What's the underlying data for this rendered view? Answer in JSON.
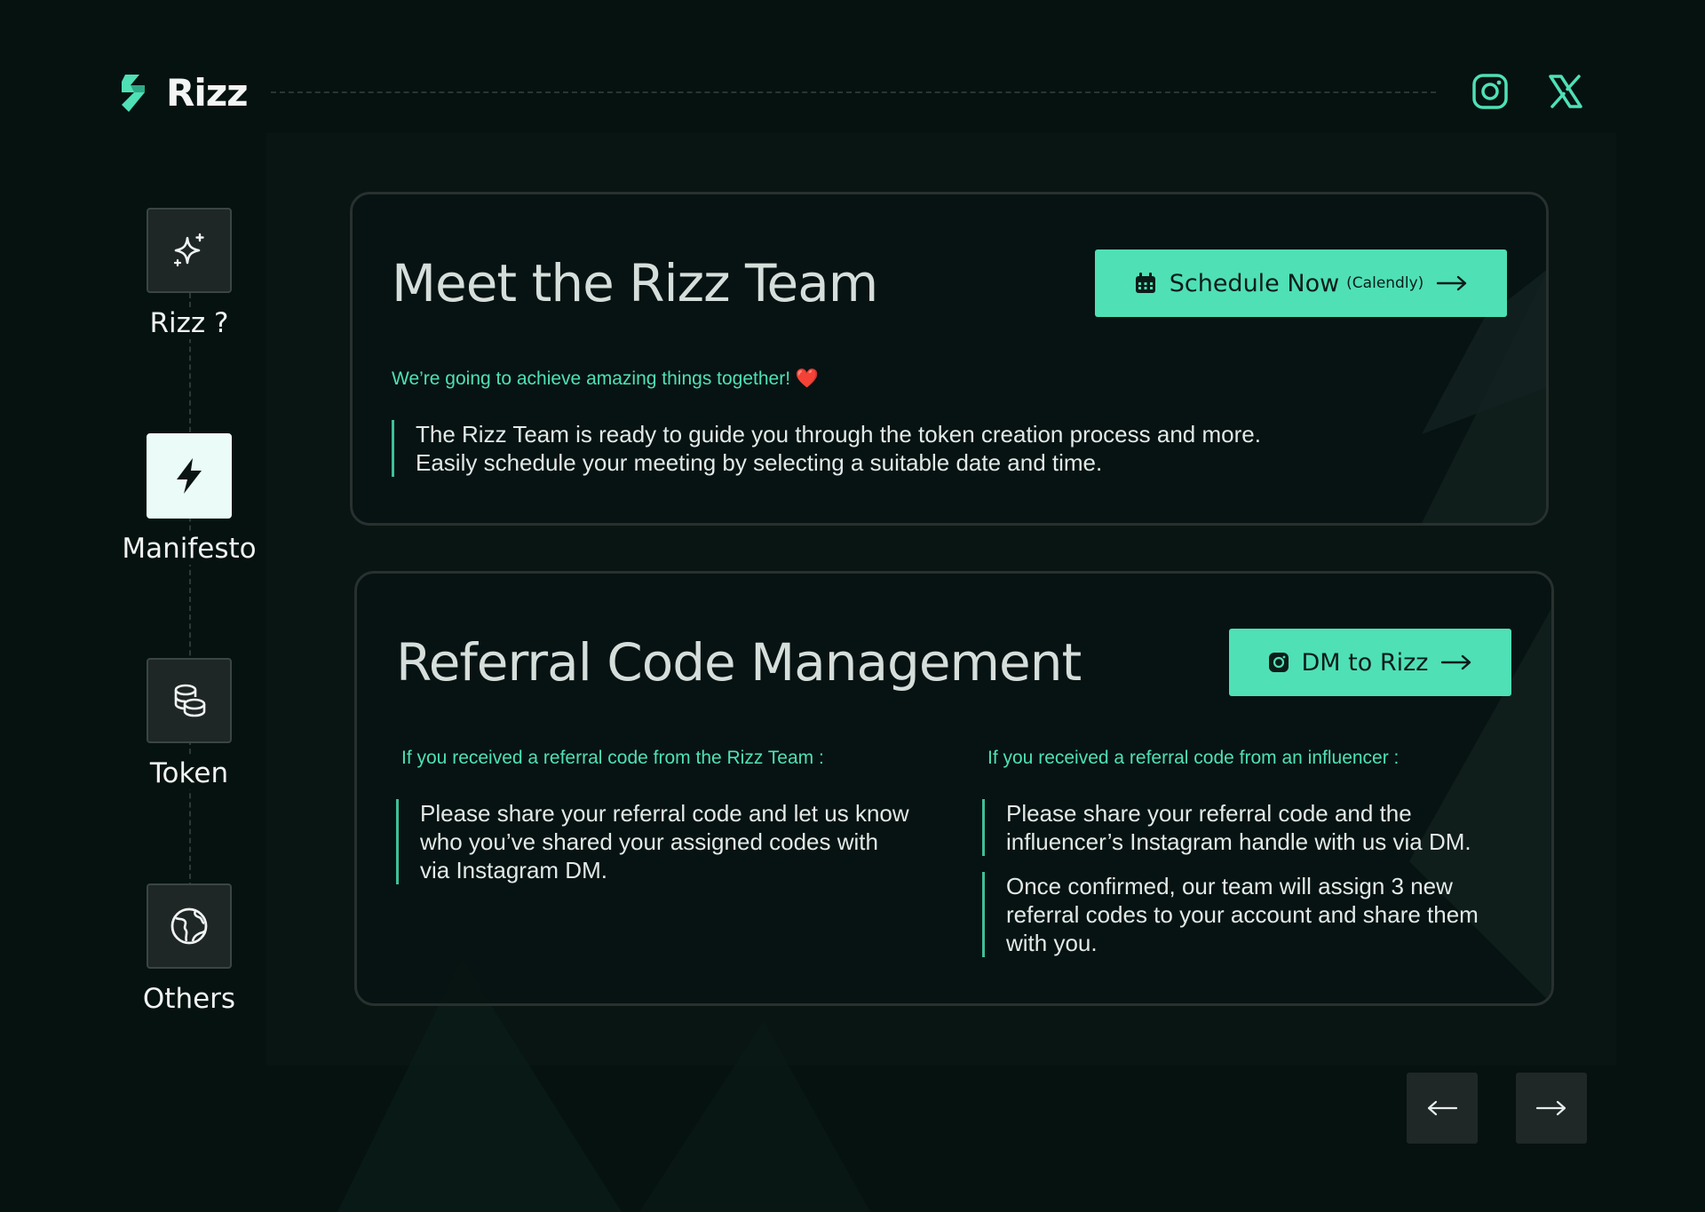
{
  "brand": {
    "name": "Rizz"
  },
  "header": {
    "social": [
      {
        "icon": "instagram-icon"
      },
      {
        "icon": "x-twitter-icon"
      }
    ]
  },
  "sidebar": {
    "items": [
      {
        "label": "Rizz ?",
        "icon": "sparkle-icon",
        "active": false
      },
      {
        "label": "Manifesto",
        "icon": "lightning-icon",
        "active": true
      },
      {
        "label": "Token",
        "icon": "coins-icon",
        "active": false
      },
      {
        "label": "Others",
        "icon": "globe-icon",
        "active": false
      }
    ]
  },
  "meet": {
    "title": "Meet the Rizz Team",
    "button_label": "Schedule Now",
    "button_sub": "(Calendly)",
    "tagline": "We’re going to achieve amazing things together! ❤️",
    "body_line1": "The Rizz Team is ready to guide you through the token creation process and more.",
    "body_line2": "Easily schedule your meeting by selecting a suitable date and time."
  },
  "referral": {
    "title": "Referral Code Management",
    "button_label": "DM to Rizz",
    "left": {
      "heading": "If you received a referral code from the Rizz Team :",
      "text": "Please share your referral code and let us know who you’ve shared your assigned codes with via Instagram DM."
    },
    "right": {
      "heading": "If you received a referral code from an influencer :",
      "text1": "Please share your referral code and the influencer’s Instagram handle with us via DM.",
      "text2": "Once confirmed, our team will assign 3 new referral codes to your account and share them with you."
    }
  },
  "colors": {
    "accent": "#4fe0b6",
    "background": "#061210",
    "card_border": "#28312f"
  }
}
